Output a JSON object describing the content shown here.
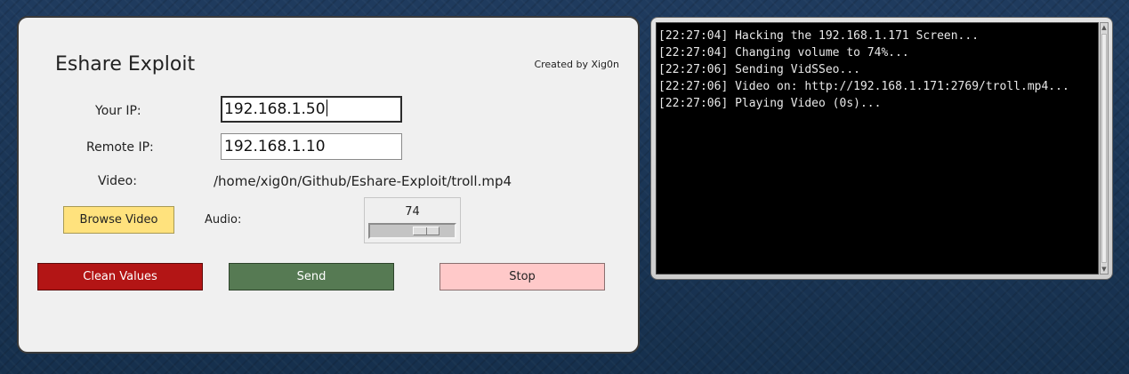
{
  "app": {
    "title": "Eshare Exploit",
    "credit": "Created by Xig0n"
  },
  "form": {
    "your_ip_label": "Your IP:",
    "your_ip_value": "192.168.1.50",
    "remote_ip_label": "Remote IP:",
    "remote_ip_value": "192.168.1.10",
    "video_label": "Video:",
    "video_path": "/home/xig0n/Github/Eshare-Exploit/troll.mp4"
  },
  "audio": {
    "label": "Audio:",
    "value": "74",
    "level_percent": 74
  },
  "buttons": {
    "browse": "Browse Video",
    "clean": "Clean Values",
    "send": "Send",
    "stop": "Stop"
  },
  "colors": {
    "browse": "#ffe27d",
    "clean": "#b31515",
    "send": "#567a53",
    "stop": "#ffc9c9"
  },
  "console": {
    "lines": [
      "[22:27:04] Hacking the 192.168.1.171 Screen...",
      "[22:27:04] Changing volume to 74%...",
      "[22:27:06] Sending VidSSeo...",
      "[22:27:06] Video on: http://192.168.1.171:2769/troll.mp4...",
      "[22:27:06] Playing Video (0s)..."
    ]
  }
}
